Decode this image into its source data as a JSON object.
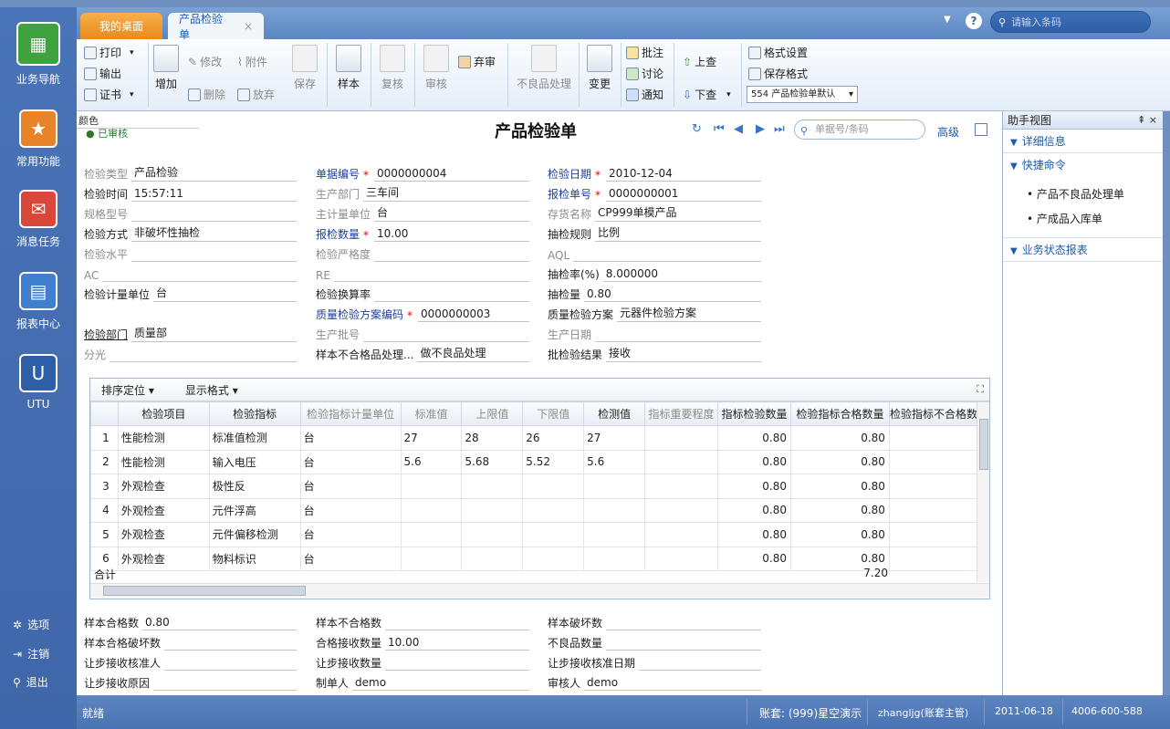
{
  "leftbar": {
    "items": [
      {
        "label": "业务导航",
        "icon": "tree-icon"
      },
      {
        "label": "常用功能",
        "icon": "star-icon"
      },
      {
        "label": "消息任务",
        "icon": "mail-icon"
      },
      {
        "label": "报表中心",
        "icon": "report-icon"
      },
      {
        "label": "UTU",
        "icon": "u-icon"
      }
    ],
    "bottom": [
      {
        "label": "选项",
        "icon": "gear-icon"
      },
      {
        "label": "注销",
        "icon": "logout-icon"
      },
      {
        "label": "退出",
        "icon": "key-icon"
      }
    ]
  },
  "tabs": {
    "home": "我的桌面",
    "doc": "产品检验单",
    "close": "×"
  },
  "search": {
    "placeholder": "请输入条码"
  },
  "toolbar": {
    "print": "打印",
    "output": "输出",
    "cert": "证书",
    "add": "增加",
    "modify": "修改",
    "attach": "附件",
    "delete": "删除",
    "abandon": "放弃",
    "save": "保存",
    "sample": "样本",
    "recheck": "复核",
    "audit": "审核",
    "reject": "弃审",
    "defect": "不良品处理",
    "change": "变更",
    "annotate": "批注",
    "discuss": "讨论",
    "notify": "通知",
    "up": "上查",
    "down": "下查",
    "format_setting": "格式设置",
    "save_format": "保存格式",
    "format_select": "554 产品检验单默认"
  },
  "doc": {
    "title": "产品检验单",
    "color_label": "颜色",
    "audit_status": "已审核",
    "nav_search_placeholder": "单据号/条码",
    "advanced": "高级"
  },
  "fields": {
    "c1": [
      {
        "label": "检验类型",
        "value": "产品检验",
        "style": "gray"
      },
      {
        "label": "检验时间",
        "value": "15:57:11",
        "style": ""
      },
      {
        "label": "规格型号",
        "value": "",
        "style": "gray"
      },
      {
        "label": "检验方式",
        "value": "非破坏性抽检",
        "style": ""
      },
      {
        "label": "检验水平",
        "value": "",
        "style": "gray"
      },
      {
        "label": "AC",
        "value": "",
        "style": "gray"
      },
      {
        "label": "检验计量单位",
        "value": "台",
        "style": ""
      },
      {
        "label": "",
        "value": "",
        "style": ""
      },
      {
        "label": "检验部门",
        "value": "质量部",
        "style": ""
      },
      {
        "label": "分光",
        "value": "",
        "style": "gray"
      }
    ],
    "c2": [
      {
        "label": "单据编号",
        "value": "0000000004",
        "style": "blue",
        "req": "*"
      },
      {
        "label": "生产部门",
        "value": "三车间",
        "style": "gray"
      },
      {
        "label": "主计量单位",
        "value": "台",
        "style": "gray"
      },
      {
        "label": "报检数量",
        "value": "10.00",
        "style": "blue",
        "req": "*"
      },
      {
        "label": "检验严格度",
        "value": "",
        "style": "gray"
      },
      {
        "label": "RE",
        "value": "",
        "style": "gray"
      },
      {
        "label": "检验换算率",
        "value": "",
        "style": ""
      },
      {
        "label": "质量检验方案编码",
        "value": "0000000003",
        "style": "blue",
        "req": "*"
      },
      {
        "label": "生产批号",
        "value": "",
        "style": "gray"
      },
      {
        "label": "样本不合格品处理...",
        "value": "做不良品处理",
        "style": ""
      }
    ],
    "c3": [
      {
        "label": "检验日期",
        "value": "2010-12-04",
        "style": "blue",
        "req": "*"
      },
      {
        "label": "报检单号",
        "value": "0000000001",
        "style": "blue",
        "req": "*"
      },
      {
        "label": "存货名称",
        "value": "CP999单模产品",
        "style": "gray"
      },
      {
        "label": "抽检规则",
        "value": "比例",
        "style": ""
      },
      {
        "label": "AQL",
        "value": "",
        "style": "gray"
      },
      {
        "label": "抽检率(%)",
        "value": "8.000000",
        "style": ""
      },
      {
        "label": "抽检量",
        "value": "0.80",
        "style": ""
      },
      {
        "label": "质量检验方案",
        "value": "元器件检验方案",
        "style": ""
      },
      {
        "label": "生产日期",
        "value": "",
        "style": "gray"
      },
      {
        "label": "批检验结果",
        "value": "接收",
        "style": ""
      }
    ]
  },
  "grid": {
    "toolbar": [
      "排序定位",
      "显示格式"
    ],
    "columns": [
      "检验项目",
      "检验指标",
      "检验指标计量单位",
      "标准值",
      "上限值",
      "下限值",
      "检测值",
      "指标重要程度",
      "指标检验数量",
      "检验指标合格数量",
      "检验指标不合格数量"
    ],
    "gray_columns": [
      2,
      3,
      4,
      5,
      7
    ],
    "rows": [
      [
        "1",
        "性能检测",
        "标准值检测",
        "台",
        "27",
        "28",
        "26",
        "27",
        "",
        "0.80",
        "0.80",
        ""
      ],
      [
        "2",
        "性能检测",
        "输入电压",
        "台",
        "5.6",
        "5.68",
        "5.52",
        "5.6",
        "",
        "0.80",
        "0.80",
        ""
      ],
      [
        "3",
        "外观检查",
        "极性反",
        "台",
        "",
        "",
        "",
        "",
        "",
        "0.80",
        "0.80",
        ""
      ],
      [
        "4",
        "外观检查",
        "元件浮高",
        "台",
        "",
        "",
        "",
        "",
        "",
        "0.80",
        "0.80",
        ""
      ],
      [
        "5",
        "外观检查",
        "元件偏移检测",
        "台",
        "",
        "",
        "",
        "",
        "",
        "0.80",
        "0.80",
        ""
      ],
      [
        "6",
        "外观检查",
        "物料标识",
        "台",
        "",
        "",
        "",
        "",
        "",
        "0.80",
        "0.80",
        ""
      ]
    ],
    "sum_label": "合计",
    "sum_value": "7.20"
  },
  "bottom_fields": {
    "c1": [
      {
        "label": "样本合格数",
        "value": "0.80"
      },
      {
        "label": "样本合格破坏数",
        "value": ""
      },
      {
        "label": "让步接收核准人",
        "value": ""
      },
      {
        "label": "让步接收原因",
        "value": ""
      }
    ],
    "c2": [
      {
        "label": "样本不合格数",
        "value": ""
      },
      {
        "label": "合格接收数量",
        "value": "10.00"
      },
      {
        "label": "让步接收数量",
        "value": ""
      },
      {
        "label": "制单人",
        "value": "demo"
      }
    ],
    "c3": [
      {
        "label": "样本破坏数",
        "value": ""
      },
      {
        "label": "不良品数量",
        "value": ""
      },
      {
        "label": "让步接收核准日期",
        "value": ""
      },
      {
        "label": "审核人",
        "value": "demo"
      }
    ]
  },
  "assist": {
    "title": "助手视图",
    "pin": "⇞ ×",
    "sections": [
      "详细信息",
      "快捷命令",
      "业务状态报表"
    ],
    "commands": [
      "产品不良品处理单",
      "产成品入库单"
    ]
  },
  "status": {
    "ready": "就绪",
    "account": "账套: (999)星空演示",
    "user": "zhangljg(账套主管)",
    "date": "2011-06-18",
    "phone": "4006-600-588"
  }
}
